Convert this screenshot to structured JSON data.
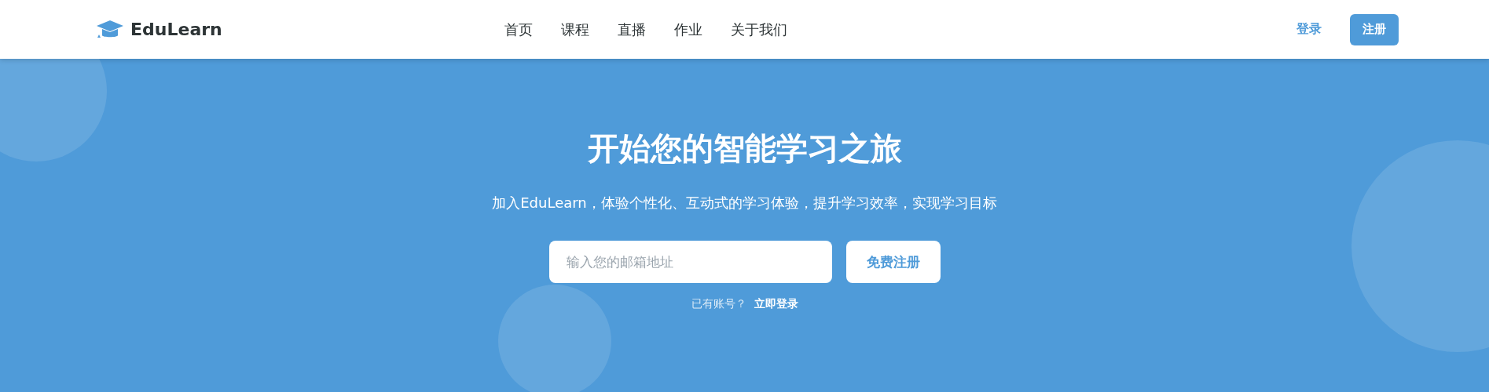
{
  "header": {
    "logo": "EduLearn",
    "nav": [
      {
        "label": "首页"
      },
      {
        "label": "课程"
      },
      {
        "label": "直播"
      },
      {
        "label": "作业"
      },
      {
        "label": "关于我们"
      }
    ],
    "login": "登录",
    "register": "注册"
  },
  "hero": {
    "title": "开始您的智能学习之旅",
    "subtitle": "加入EduLearn，体验个性化、互动式的学习体验，提升学习效率，实现学习目标",
    "email": {
      "placeholder": "输入您的邮箱地址"
    },
    "signup": "免费注册",
    "account_prompt": "已有账号？",
    "login_link": "立即登录"
  }
}
